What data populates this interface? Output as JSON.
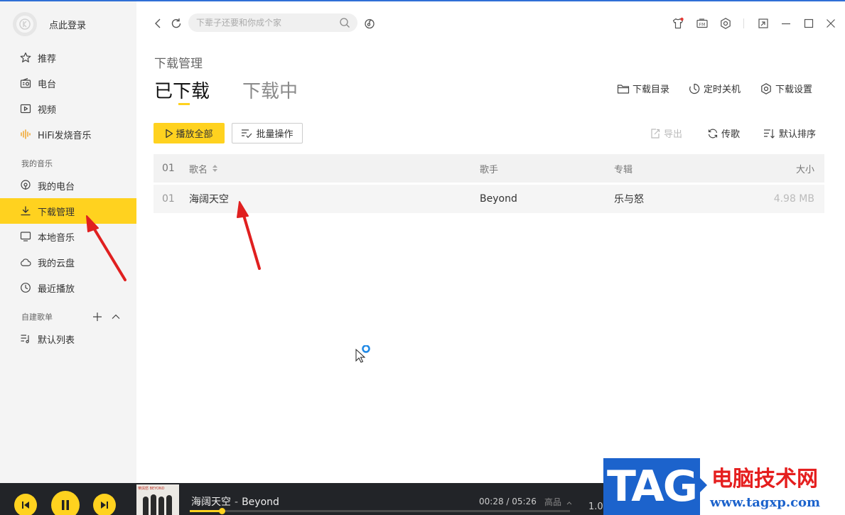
{
  "window": {
    "accent_color": "#ffd21f",
    "topline_color": "#2f6fd6"
  },
  "sidebar": {
    "login_text": "点此登录",
    "items": [
      {
        "label": "推荐",
        "icon": "star-icon"
      },
      {
        "label": "电台",
        "icon": "radio-icon"
      },
      {
        "label": "视频",
        "icon": "video-icon"
      },
      {
        "label": "HiFi发烧音乐",
        "icon": "hifi-icon"
      }
    ],
    "my_music_label": "我的音乐",
    "my_music_items": [
      {
        "label": "我的电台",
        "icon": "podcast-icon"
      },
      {
        "label": "下载管理",
        "icon": "download-icon",
        "active": true
      },
      {
        "label": "本地音乐",
        "icon": "monitor-icon"
      },
      {
        "label": "我的云盘",
        "icon": "cloud-icon"
      },
      {
        "label": "最近播放",
        "icon": "clock-icon"
      }
    ],
    "playlist_section_label": "自建歌单",
    "playlists": [
      {
        "label": "默认列表",
        "icon": "playlist-icon"
      }
    ]
  },
  "toolbar": {
    "search_placeholder": "下辈子还要和你成个家"
  },
  "page": {
    "breadcrumb": "下载管理",
    "tabs": [
      {
        "label": "已下载",
        "active": true
      },
      {
        "label": "下载中",
        "active": false
      }
    ],
    "top_actions": [
      "下载目录",
      "定时关机",
      "下载设置"
    ],
    "play_all_label": "播放全部",
    "batch_label": "批量操作",
    "right_actions": {
      "export": "导出",
      "transfer": "传歌",
      "sort": "默认排序"
    }
  },
  "table": {
    "header": {
      "index": "01",
      "name": "歌名",
      "artist": "歌手",
      "album": "专辑",
      "size": "大小"
    },
    "rows": [
      {
        "index": "01",
        "name": "海阔天空",
        "artist": "Beyond",
        "album": "乐与怒",
        "size": "4.98 MB"
      }
    ]
  },
  "player": {
    "track_title": "海阔天空",
    "separator": "-",
    "track_artist": "Beyond",
    "time": "00:28 / 05:26",
    "quality": "高品",
    "speed": "1.0x",
    "progress": 0.0859,
    "cover_text": "樂與怒 BEYOND"
  },
  "watermark": {
    "tag": "TAG",
    "title": "电脑技术网",
    "url": "www.tagxp.com"
  }
}
